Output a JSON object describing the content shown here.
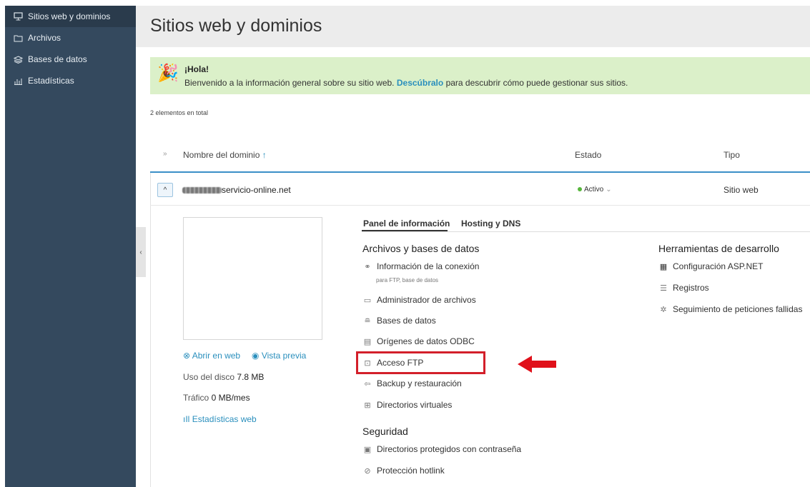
{
  "sidebar": {
    "items": [
      {
        "label": "Sitios web y dominios",
        "icon": "monitor-icon",
        "active": true
      },
      {
        "label": "Archivos",
        "icon": "folder-icon"
      },
      {
        "label": "Bases de datos",
        "icon": "database-icon"
      },
      {
        "label": "Estadísticas",
        "icon": "bar-chart-icon"
      }
    ]
  },
  "header": {
    "title": "Sitios web y dominios"
  },
  "banner": {
    "title": "¡Hola!",
    "text_before": "Bienvenido a la información general sobre su sitio web.",
    "link": "Descúbralo",
    "text_after": "para descubrir cómo puede gestionar sus sitios."
  },
  "table": {
    "count": "2 elementos en total",
    "columns": {
      "name": "Nombre del dominio",
      "sort": "↑",
      "status": "Estado",
      "type": "Tipo"
    }
  },
  "domain": {
    "name_suffix": "servicio-online.net",
    "status": "Activo",
    "type": "Sitio web"
  },
  "left_panel": {
    "open_web": "Abrir en web",
    "preview": "Vista previa",
    "disk_label": "Uso del disco",
    "disk_value": "7.8 MB",
    "traffic_label": "Tráfico",
    "traffic_value": "0 MB/mes",
    "stats": "Estadísticas web"
  },
  "tabs": [
    "Panel de información",
    "Hosting y DNS"
  ],
  "files_section": {
    "title": "Archivos y bases de datos",
    "items": [
      {
        "label": "Información de la conexión",
        "sub": "para FTP, base de datos"
      },
      {
        "label": "Administrador de archivos"
      },
      {
        "label": "Bases de datos"
      },
      {
        "label": "Orígenes de datos ODBC"
      },
      {
        "label": "Acceso FTP"
      },
      {
        "label": "Backup y restauración"
      },
      {
        "label": "Directorios virtuales"
      }
    ]
  },
  "security_section": {
    "title": "Seguridad",
    "items": [
      {
        "label": "Directorios protegidos con contraseña"
      },
      {
        "label": "Protección hotlink"
      }
    ]
  },
  "dev_section": {
    "title": "Herramientas de desarrollo",
    "items": [
      {
        "label": "Configuración ASP.NET"
      },
      {
        "label": "Registros"
      },
      {
        "label": "Seguimiento de peticiones fallidas"
      }
    ]
  },
  "colors": {
    "accent": "#2a8fbd",
    "sidebar": "#34495e",
    "banner": "#dbf0c9",
    "highlight": "#d31f2a",
    "status_ok": "#57b63c"
  }
}
